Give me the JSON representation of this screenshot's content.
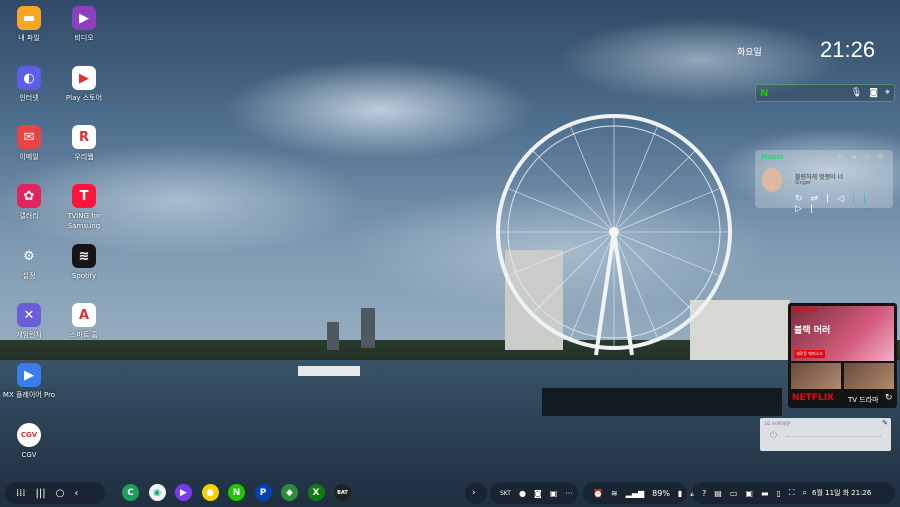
{
  "desktop_icons": [
    {
      "label": "내 파일",
      "color": "#f5a623",
      "glyph": "▬",
      "icon": "folder-icon"
    },
    {
      "label": "비디오",
      "color": "#8e3fbf",
      "glyph": "▶",
      "icon": "video-icon"
    },
    {
      "label": "인터넷",
      "color": "#5b5fe8",
      "glyph": "◐",
      "icon": "internet-icon"
    },
    {
      "label": "Play 스토어",
      "color": "#ffffff",
      "glyph": "▶",
      "icon": "play-store-icon"
    },
    {
      "label": "이메일",
      "color": "#e64545",
      "glyph": "✉",
      "icon": "email-icon"
    },
    {
      "label": "우리웹",
      "color": "#ffffff",
      "glyph": "R",
      "icon": "rpg-app-icon"
    },
    {
      "label": "갤러리",
      "color": "#e0245e",
      "glyph": "✿",
      "icon": "gallery-icon"
    },
    {
      "label": "TVING for Samsung",
      "color": "#ff153c",
      "glyph": "T",
      "icon": "tving-icon"
    },
    {
      "label": "설정",
      "color": "transparent",
      "glyph": "⚙",
      "icon": "settings-icon"
    },
    {
      "label": "Spotify",
      "color": "#191414",
      "glyph": "≋",
      "icon": "spotify-icon"
    },
    {
      "label": "게임런처",
      "color": "#6b5ed6",
      "glyph": "✕",
      "icon": "game-launcher-icon"
    },
    {
      "label": "스마트 홈",
      "color": "#ffffff",
      "glyph": "A",
      "icon": "smart-home-icon"
    },
    {
      "label": "MX 플레이어 Pro",
      "color": "#3b7de8",
      "glyph": "▶",
      "icon": "mx-player-icon"
    },
    {
      "label": "CGV",
      "color": "#ffffff",
      "glyph": "CGV",
      "icon": "cgv-icon"
    }
  ],
  "clock": {
    "day": "화요일",
    "time": "21:26"
  },
  "search_widget": {
    "logo": "N",
    "mic": "mic-icon",
    "lens": "lens-icon",
    "location": "location-icon"
  },
  "music_widget": {
    "app": "Music",
    "song": "블링하게 멋쟁이 너",
    "artist": "Singer",
    "controls": [
      "↻",
      "⇌",
      "|◁",
      "||",
      "▷|"
    ]
  },
  "netflix_widget": {
    "logo": "NETFLIX",
    "show": "블랙 머러",
    "badge": "새로운 에피소드",
    "bottom_logo": "NETFLIX",
    "category": "TV 드라마",
    "refresh": "↻"
  },
  "smart_home_widget": {
    "title": "LG 스마트씽큐",
    "edit": "✎",
    "power": "⏻"
  },
  "taskbar": {
    "nav": [
      "⁞⁞⁞",
      "|||",
      "○",
      "‹"
    ],
    "apps": [
      {
        "glyph": "C",
        "color": "#1e9e5e",
        "icon": "phone-icon"
      },
      {
        "glyph": "◉",
        "color": "#f2f2f2",
        "icon": "camera-icon"
      },
      {
        "glyph": "▶",
        "color": "#7c3aed",
        "icon": "media-icon"
      },
      {
        "glyph": "●",
        "color": "#f7d000",
        "icon": "kakaotalk-icon"
      },
      {
        "glyph": "N",
        "color": "#1ec800",
        "icon": "naver-icon"
      },
      {
        "glyph": "P",
        "color": "#0041b3",
        "icon": "playstation-icon"
      },
      {
        "glyph": "◆",
        "color": "#2e8b3a",
        "icon": "game-icon"
      },
      {
        "glyph": "X",
        "color": "#107c10",
        "icon": "xbox-icon"
      },
      {
        "glyph": "BAT",
        "color": "#222222",
        "icon": "battery-app-icon"
      }
    ],
    "expand": "›",
    "carrier": "SKT",
    "status_more": "···",
    "battery": "89%",
    "date": "6월 11일 화",
    "time": "21:26"
  }
}
